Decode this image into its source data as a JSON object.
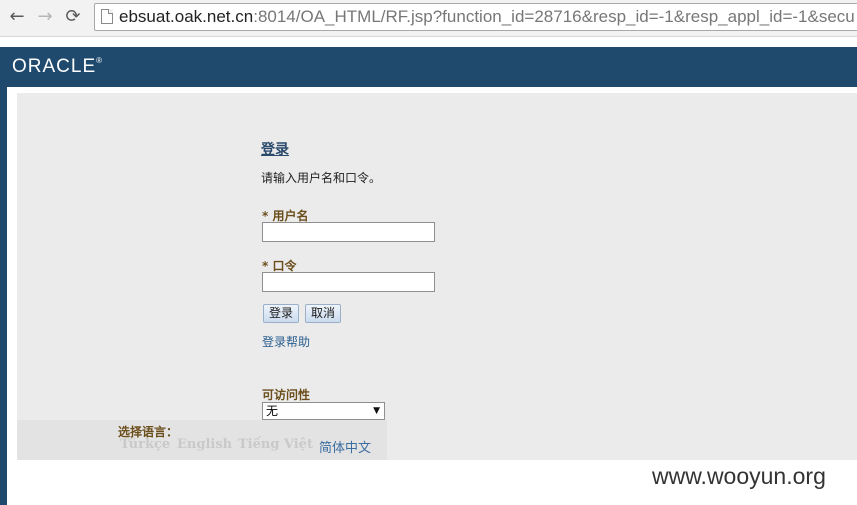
{
  "browser": {
    "back_glyph": "←",
    "forward_glyph": "→",
    "reload_glyph": "⟳",
    "url_host": "ebsuat.oak.net.cn",
    "url_rest": ":8014/OA_HTML/RF.jsp?function_id=28716&resp_id=-1&resp_appl_id=-1&secu"
  },
  "banner": {
    "logo_text": "ORACLE",
    "logo_mark": "®",
    "color": "#1f4a6e"
  },
  "login": {
    "title": "登录",
    "instruction": "请输入用户名和口令。",
    "required_marker": "*",
    "username_label": "用户名",
    "username_value": "",
    "password_label": "口令",
    "password_value": "",
    "login_button": "登录",
    "cancel_button": "取消",
    "help_link": "登录帮助",
    "accessibility_label": "可访问性",
    "accessibility_selected": "无"
  },
  "language": {
    "label": "选择语言：",
    "options": [
      "Türkçe",
      "English",
      "Tiếng Việt",
      "简体中文"
    ],
    "active": "简体中文"
  },
  "watermark": "www.wooyun.org"
}
